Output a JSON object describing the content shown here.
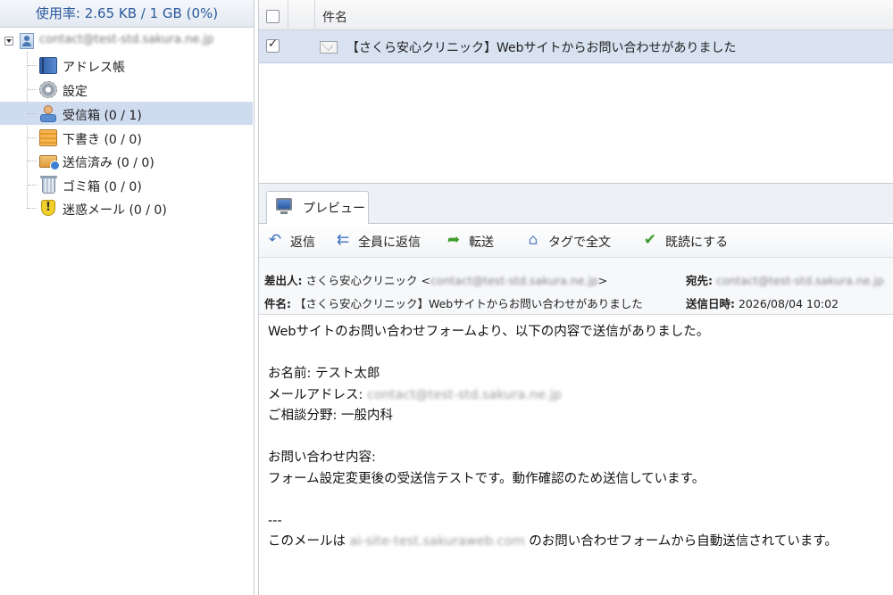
{
  "usage": {
    "label": "使用率: 2.65 KB / 1 GB (0%)"
  },
  "account": {
    "name": "contact@test-std.sakura.ne.jp"
  },
  "folders": [
    {
      "label": "アドレス帳",
      "icon": "address-book-icon"
    },
    {
      "label": "設定",
      "icon": "gear-icon"
    },
    {
      "label": "受信箱 (0 / 1)",
      "icon": "inbox-icon",
      "selected": true
    },
    {
      "label": "下書き (0 / 0)",
      "icon": "drafts-icon"
    },
    {
      "label": "送信済み (0 / 0)",
      "icon": "sent-icon"
    },
    {
      "label": "ゴミ箱 (0 / 0)",
      "icon": "trash-icon"
    },
    {
      "label": "迷惑メール (0 / 0)",
      "icon": "spam-icon"
    }
  ],
  "message_list": {
    "column_subject": "件名",
    "messages": [
      {
        "subject": "【さくら安心クリニック】Webサイトからお問い合わせがありました",
        "checked": true
      }
    ]
  },
  "preview": {
    "tab_label": "プレビュー",
    "toolbar": {
      "reply": "返信",
      "reply_all": "全員に返信",
      "forward": "転送",
      "tag_fulltext": "タグで全文",
      "mark_read": "既読にする"
    },
    "headers": {
      "from_label": "差出人:",
      "from_name": "さくら安心クリニック <",
      "from_email": "contact@test-std.sakura.ne.jp",
      "from_close": ">",
      "to_label": "宛先:",
      "to_value": "contact@test-std.sakura.ne.jp",
      "subject_label": "件名:",
      "subject_value": "【さくら安心クリニック】Webサイトからお問い合わせがありました",
      "date_label": "送信日時:",
      "date_value": "2026/08/04 10:02"
    },
    "body": {
      "intro": "Webサイトのお問い合わせフォームより、以下の内容で送信がありました。",
      "name_line": "お名前:  テスト太郎",
      "email_label": "メールアドレス: ",
      "email_value": "contact@test-std.sakura.ne.jp",
      "category_line": "ご相談分野:  一般内科",
      "inquiry_label": "お問い合わせ内容:",
      "inquiry_text": "フォーム設定変更後の受送信テストです。動作確認のため送信しています。",
      "separator": "---",
      "footer_prefix": "このメールは ",
      "footer_site": "ai-site-test.sakuraweb.com",
      "footer_suffix": " のお問い合わせフォームから自動送信されています。"
    }
  },
  "colors": {
    "usage_text": "#2b5a9c",
    "selected_row": "#d8e2f1",
    "selected_folder": "#cfdbef",
    "toolbar_icon_blue": "#3f73bd",
    "toolbar_icon_green": "#3e9b2e"
  }
}
